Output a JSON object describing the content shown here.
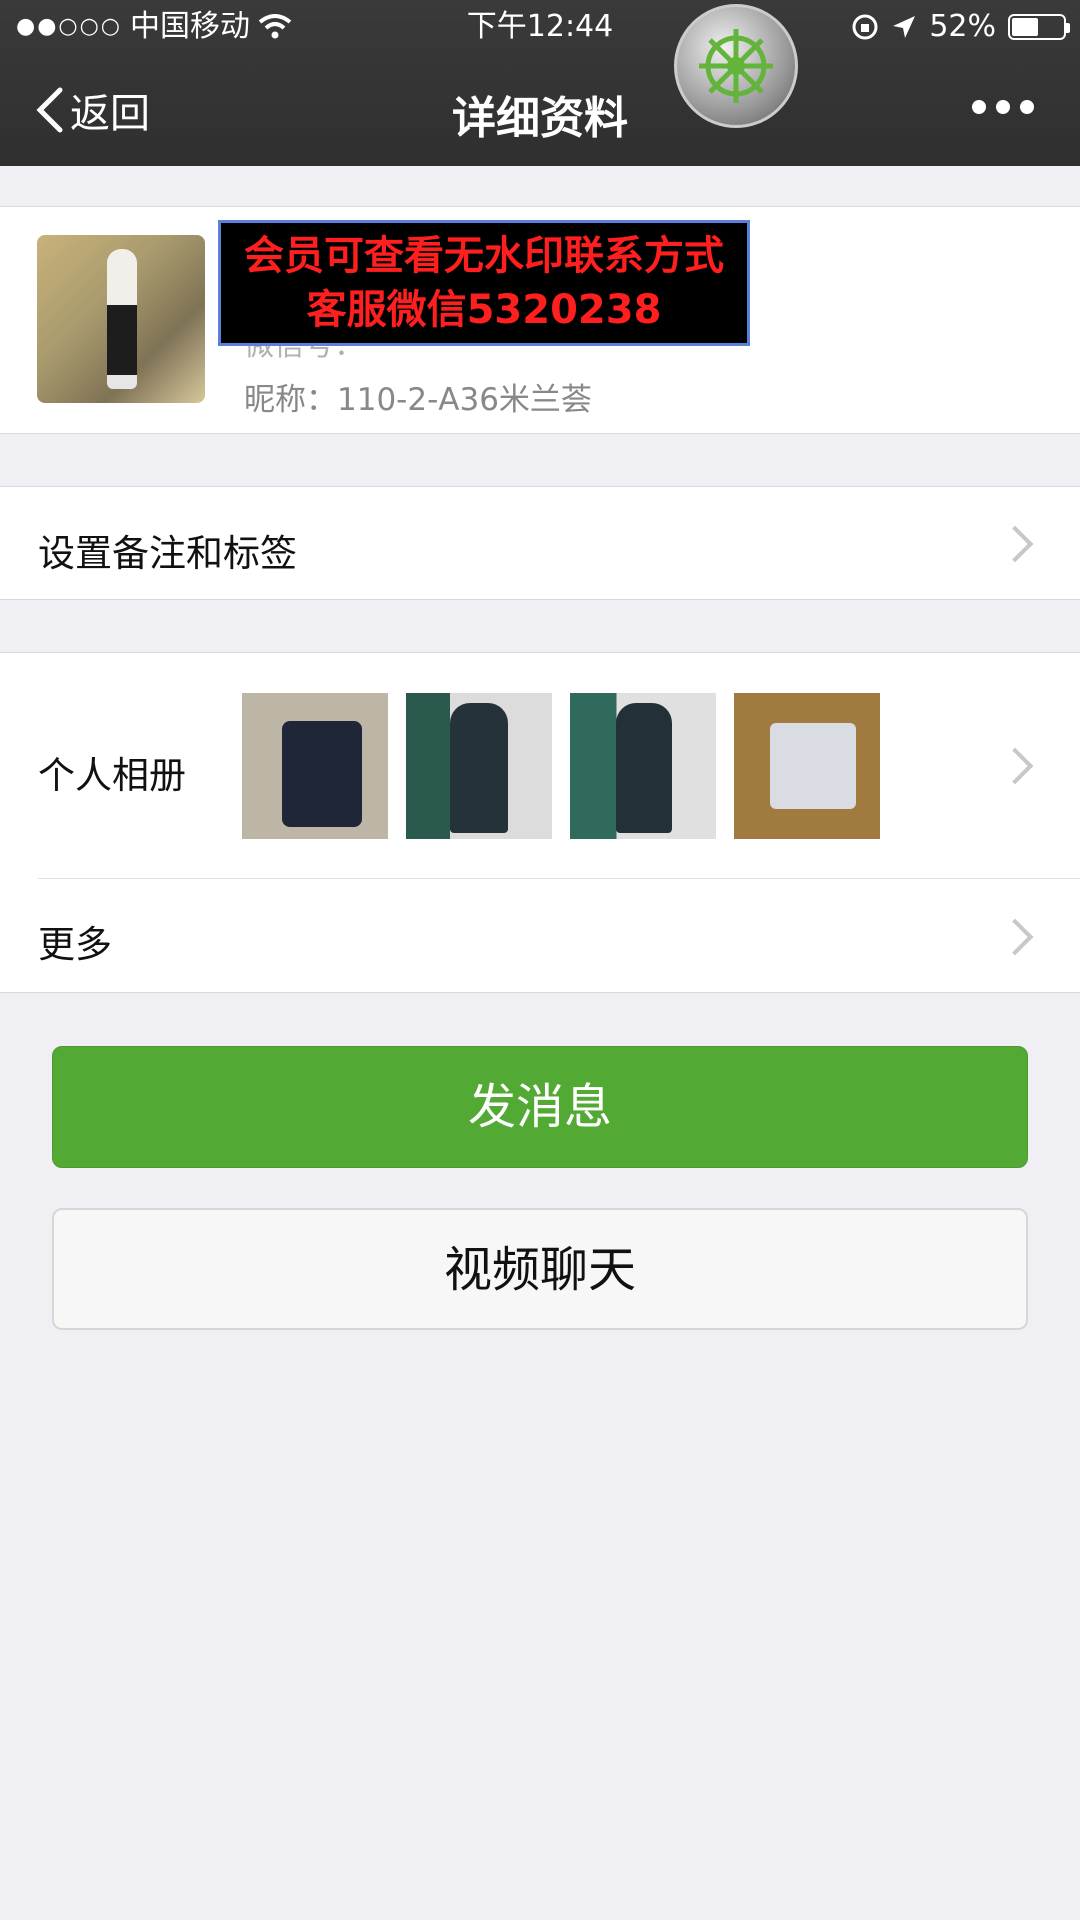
{
  "status_bar": {
    "signal": "●●○○○",
    "carrier": "中国移动",
    "time": "下午12:44",
    "battery_percent": "52%",
    "battery_level": 0.52
  },
  "nav": {
    "back_label": "返回",
    "title": "详细资料"
  },
  "profile": {
    "watermark_line1": "会员可查看无水印联系方式",
    "watermark_line2": "客服微信5320238",
    "wechat_id_partial": "微信号：",
    "nickname": "昵称：110-2-A36米兰荟"
  },
  "cells": {
    "remark_label": "设置备注和标签",
    "album_label": "个人相册",
    "more_label": "更多"
  },
  "buttons": {
    "send_message": "发消息",
    "video_chat": "视频聊天"
  },
  "colors": {
    "header_bg": "#333333",
    "primary_green": "#52a934",
    "watermark_text": "#ff1f1f"
  }
}
